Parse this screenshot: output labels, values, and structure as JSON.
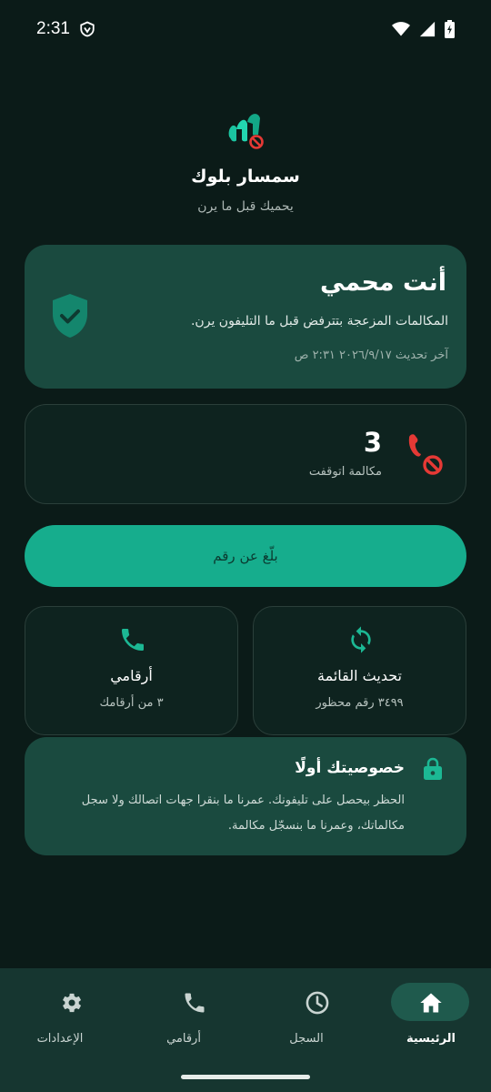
{
  "status_bar": {
    "time": "2:31"
  },
  "app": {
    "name": "سمسار بلوك",
    "tagline": "يحميك قبل ما يرن"
  },
  "protection": {
    "title": "أنت محمي",
    "description": "المكالمات المزعجة بتترفض قبل ما التليفون يرن.",
    "last_updated": "آخر تحديث ٢٠٢٦/٩/١٧ ٢:٣١ ص"
  },
  "stats": {
    "blocked_count": "3",
    "blocked_label": "مكالمة اتوقفت"
  },
  "report_button": {
    "label": "بلّغ عن رقم"
  },
  "cards": {
    "update_list": {
      "title": "تحديث القائمة",
      "subtitle": "٣٤٩٩ رقم محظور"
    },
    "my_numbers": {
      "title": "أرقامي",
      "subtitle": "٣ من أرقامك"
    }
  },
  "privacy": {
    "title": "خصوصيتك أولًا",
    "body": "الحظر بيحصل على تليفونك. عمرنا ما بنقرا جهات اتصالك ولا سجل مكالماتك، وعمرنا ما بنسجّل مكالمة."
  },
  "nav": {
    "home": "الرئيسية",
    "log": "السجل",
    "numbers": "أرقامي",
    "settings": "الإعدادات"
  },
  "colors": {
    "accent": "#16ad8d",
    "background": "#0b1b18",
    "card_green": "#1a4a3f",
    "blocked_red": "#e53935"
  }
}
